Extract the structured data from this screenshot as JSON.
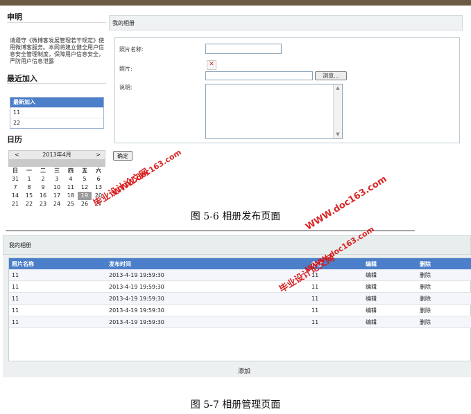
{
  "figure1": {
    "sidebar": {
      "notice_title": "申明",
      "notice_text": "请遵守《微博客发展管理若干规定》使用微博客服务。本网将建立健全用户信息安全管理制度，保障用户信息安全，严防用户信息泄露",
      "recent_title": "最近加入",
      "recent_header": "最新加入",
      "recent_items": [
        "11",
        "22"
      ],
      "calendar_title": "日历",
      "calendar": {
        "prev": "<",
        "month_label": "2013年4月",
        "next": ">",
        "weekdays": [
          "日",
          "一",
          "二",
          "三",
          "四",
          "五",
          "六"
        ],
        "weeks": [
          [
            "31",
            "1",
            "2",
            "3",
            "4",
            "5",
            "6"
          ],
          [
            "7",
            "8",
            "9",
            "10",
            "11",
            "12",
            "13"
          ],
          [
            "14",
            "15",
            "16",
            "17",
            "18",
            "19",
            "20"
          ],
          [
            "21",
            "22",
            "23",
            "24",
            "25",
            "26",
            "27"
          ]
        ],
        "selected_day": "19"
      }
    },
    "main": {
      "title": "我的相册",
      "form": {
        "name_label": "照片名称:",
        "name_value": "",
        "photo_label": "照片:",
        "photo_broken_icon": "✕",
        "file_value": "",
        "browse_label": "浏览...",
        "desc_label": "说明:",
        "desc_value": "",
        "submit_label": "确定"
      }
    },
    "caption": "图 5-6 相册发布页面"
  },
  "figure2": {
    "title": "我的相册",
    "table": {
      "headers": [
        "照片名称",
        "发布时间",
        "备注",
        "编辑",
        "删除"
      ],
      "rows": [
        [
          "11",
          "2013-4-19 19:59:30",
          "11",
          "编辑",
          "删除"
        ],
        [
          "11",
          "2013-4-19 19:59:30",
          "11",
          "编辑",
          "删除"
        ],
        [
          "11",
          "2013-4-19 19:59:30",
          "11",
          "编辑",
          "删除"
        ],
        [
          "11",
          "2013-4-19 19:59:30",
          "11",
          "编辑",
          "删除"
        ],
        [
          "11",
          "2013-4-19 19:59:30",
          "11",
          "编辑",
          "删除"
        ]
      ]
    },
    "add_label": "添加",
    "caption": "图 5-7 相册管理页面"
  },
  "watermarks": {
    "site": "毕业设计论文网",
    "url": "WWW.doc163.com"
  },
  "colors": {
    "header_blue": "#4b7fc9",
    "watermark_red": "#d91414",
    "top_bar": "#6b5a44"
  }
}
